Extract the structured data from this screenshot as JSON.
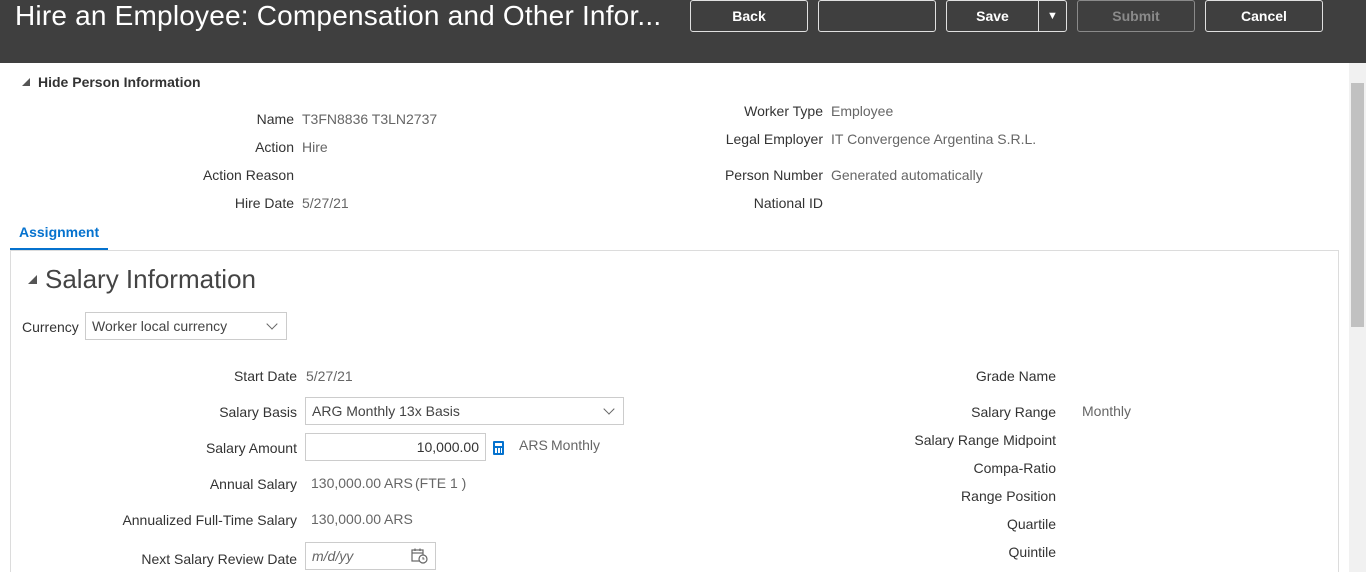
{
  "header": {
    "title": "Hire an Employee: Compensation and Other Infor...",
    "back_label": "Back",
    "blank_label": "",
    "save_label": "Save",
    "submit_label": "Submit",
    "cancel_label": "Cancel"
  },
  "person": {
    "toggle_label": "Hide Person Information",
    "name_label": "Name",
    "name_value": "T3FN8836 T3LN2737",
    "action_label": "Action",
    "action_value": "Hire",
    "action_reason_label": "Action Reason",
    "hire_date_label": "Hire Date",
    "hire_date_value": "5/27/21",
    "worker_type_label": "Worker Type",
    "worker_type_value": "Employee",
    "legal_employer_label": "Legal Employer",
    "legal_employer_value": "IT Convergence Argentina S.R.L.",
    "person_number_label": "Person Number",
    "person_number_value": "Generated automatically",
    "national_id_label": "National ID"
  },
  "tabs": {
    "assignment": "Assignment"
  },
  "salary": {
    "section_title": "Salary Information",
    "currency_label": "Currency",
    "currency_value": "Worker local currency",
    "start_date_label": "Start Date",
    "start_date_value": "5/27/21",
    "salary_basis_label": "Salary Basis",
    "salary_basis_value": "ARG Monthly 13x Basis",
    "salary_amount_label": "Salary Amount",
    "salary_amount_value": "10,000.00",
    "salary_amount_currency": "ARS",
    "salary_amount_freq": "Monthly",
    "annual_salary_label": "Annual Salary",
    "annual_salary_value": "130,000.00",
    "annual_salary_currency": "ARS",
    "annual_salary_fte": "(FTE 1 )",
    "annualized_label": "Annualized Full-Time Salary",
    "annualized_value": "130,000.00",
    "annualized_currency": "ARS",
    "next_review_label": "Next Salary Review Date",
    "next_review_placeholder": "m/d/yy",
    "grade_name_label": "Grade Name",
    "salary_range_label": "Salary Range",
    "salary_range_value": "Monthly",
    "midpoint_label": "Salary Range Midpoint",
    "compa_ratio_label": "Compa-Ratio",
    "range_position_label": "Range Position",
    "quartile_label": "Quartile",
    "quintile_label": "Quintile"
  },
  "icons": {
    "calculator": "calculator-icon",
    "calendar": "calendar-icon",
    "dropdown": "chevron-down-icon"
  },
  "colors": {
    "header_bg": "#3f3f3f",
    "accent": "#0572ce"
  }
}
